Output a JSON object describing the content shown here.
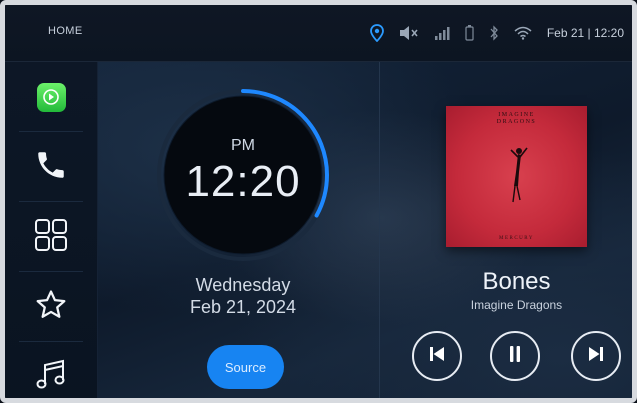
{
  "header": {
    "home_label": "HOME",
    "datetime": "Feb 21 | 12:20",
    "status_icons": [
      "location-pin-icon",
      "mute-icon",
      "signal-icon",
      "battery-icon",
      "bluetooth-icon",
      "wifi-icon"
    ],
    "accent_color": "#1e88ff"
  },
  "sidebar": {
    "items": [
      {
        "name": "carplay",
        "icon": "carplay-icon"
      },
      {
        "name": "phone",
        "icon": "phone-icon"
      },
      {
        "name": "apps",
        "icon": "grid-icon"
      },
      {
        "name": "favorites",
        "icon": "star-icon"
      },
      {
        "name": "music",
        "icon": "music-note-icon"
      }
    ]
  },
  "clock": {
    "ampm": "PM",
    "time": "12:20",
    "day": "Wednesday",
    "date": "Feb 21, 2024",
    "ring_progress": 0.33
  },
  "source_button": {
    "label": "Source"
  },
  "now_playing": {
    "album_title_line1": "IMAGINE",
    "album_title_line2": "DRAGONS",
    "album_footer": "MERCURY",
    "title": "Bones",
    "artist": "Imagine Dragons",
    "controls": [
      "previous",
      "pause",
      "next"
    ]
  }
}
